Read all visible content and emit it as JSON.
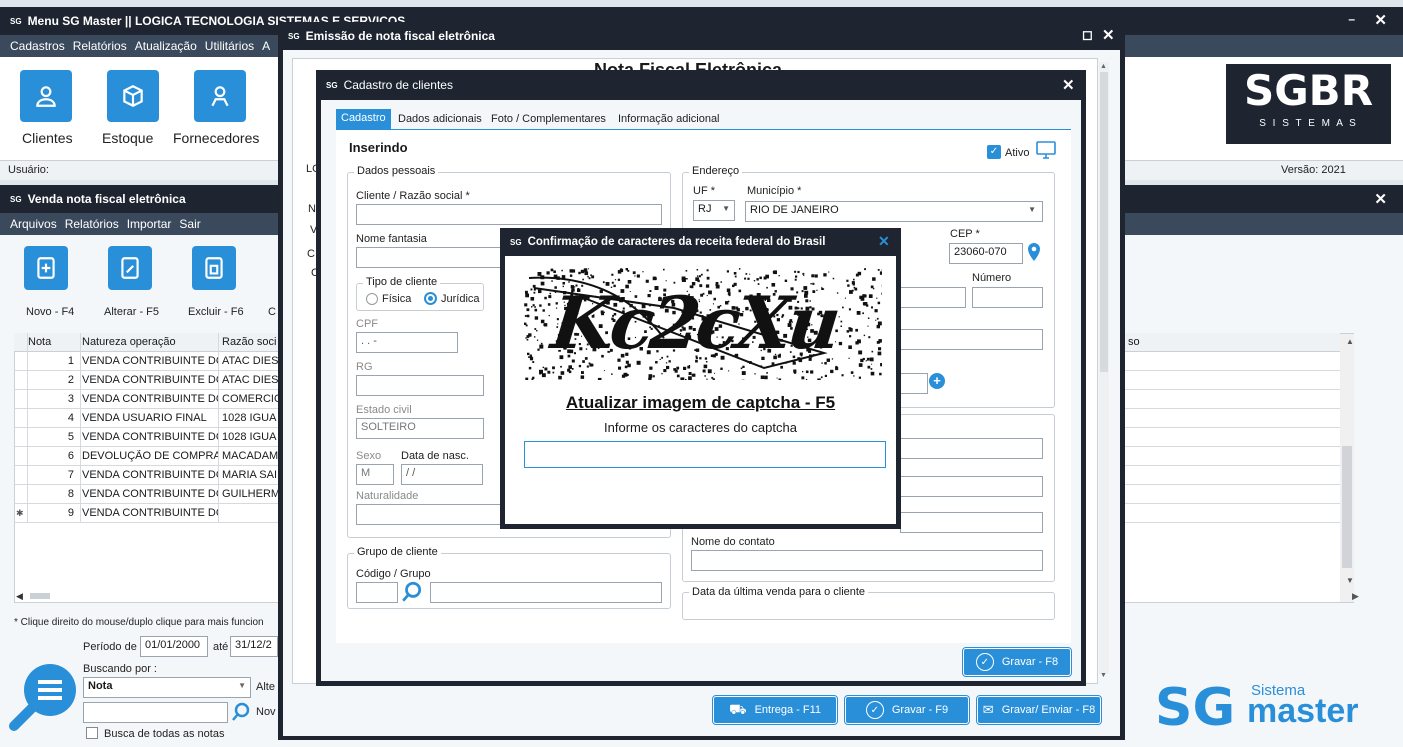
{
  "main_window": {
    "title": "Menu SG Master || LOGICA TECNOLOGIA SISTEMAS E SERVIÇOS",
    "controls": {
      "minimize": "–",
      "close": "✕"
    },
    "menu": [
      "Cadastros",
      "Relatórios",
      "Atualização",
      "Utilitários",
      "A"
    ],
    "tiles": [
      {
        "label": "Clientes",
        "icon": "user-icon"
      },
      {
        "label": "Estoque",
        "icon": "box-icon"
      },
      {
        "label": "Fornecedores",
        "icon": "users-icon"
      }
    ],
    "usuario_label": "Usuário:",
    "versao": "Versão: 2021",
    "logo_text": "SGBR",
    "logo_sub": "S I S T E M A S"
  },
  "venda_window": {
    "title": "Venda nota fiscal eletrônica",
    "menu": [
      "Arquivos",
      "Relatórios",
      "Importar",
      "Sair"
    ],
    "tools": [
      {
        "label": "Novo - F4",
        "icon": "new-document-icon"
      },
      {
        "label": "Alterar - F5",
        "icon": "edit-document-icon"
      },
      {
        "label": "Excluir - F6",
        "icon": "delete-document-icon"
      },
      {
        "label": "C",
        "icon": ""
      }
    ],
    "grid": {
      "columns": [
        "Nota",
        "Natureza operação",
        "Razão soci",
        "so"
      ],
      "rows": [
        {
          "nota": "1",
          "natureza": "VENDA CONTRIBUINTE DO",
          "razao": "ATAC DIES"
        },
        {
          "nota": "2",
          "natureza": "VENDA CONTRIBUINTE DO",
          "razao": "ATAC DIES"
        },
        {
          "nota": "3",
          "natureza": "VENDA CONTRIBUINTE DO",
          "razao": "COMERCIO"
        },
        {
          "nota": "4",
          "natureza": "VENDA USUARIO FINAL",
          "razao": "1028 IGUA"
        },
        {
          "nota": "5",
          "natureza": "VENDA CONTRIBUINTE DO",
          "razao": "1028 IGUA"
        },
        {
          "nota": "6",
          "natureza": "DEVOLUÇÃO DE COMPRA",
          "razao": "MACADAM"
        },
        {
          "nota": "7",
          "natureza": "VENDA CONTRIBUINTE DO",
          "razao": "MARIA SAI"
        },
        {
          "nota": "8",
          "natureza": "VENDA CONTRIBUINTE DO",
          "razao": "GUILHERM"
        },
        {
          "nota": "9",
          "natureza": "VENDA CONTRIBUINTE DO",
          "razao": ""
        }
      ],
      "new_row_marker": "✱"
    },
    "hint": "* Clique direito do mouse/duplo clique para mais funcion",
    "periodo_label": "Período de",
    "periodo_de": "01/01/2000",
    "ate_label": "até",
    "periodo_ate": "31/12/2",
    "buscando_label": "Buscando por :",
    "buscando_value": "Nota",
    "alte_label": "Alte",
    "nov_label": "Nov",
    "busca_todas": "Busca de todas as notas"
  },
  "nfe_window": {
    "title": "Emissão de nota fiscal eletrônica",
    "controls": {
      "maximize": "◻",
      "close": "✕"
    },
    "heading": "Nota Fiscal Eletrônica",
    "side_labels": [
      "LO",
      "N",
      "V",
      "C",
      "C"
    ],
    "buttons": [
      {
        "label": "Entrega - F11",
        "icon": "truck-icon"
      },
      {
        "label": "Gravar - F9",
        "icon": "check-icon"
      },
      {
        "label": "Gravar/ Enviar - F8",
        "icon": "send-icon"
      }
    ]
  },
  "cliente_dialog": {
    "title": "Cadastro de clientes",
    "tabs": [
      "Cadastro",
      "Dados adicionais",
      "Foto / Complementares",
      "Informação adicional"
    ],
    "mode": "Inserindo",
    "ativo_label": "Ativo",
    "dados_pessoais": "Dados pessoais",
    "cliente_label": "Cliente / Razão social *",
    "nome_fantasia_label": "Nome fantasia",
    "tipo_cliente_label": "Tipo de cliente",
    "fisica_label": "Física",
    "juridica_label": "Jurídica",
    "cpf_label": "CPF",
    "cpf_value": "  .  .  -",
    "rg_label": "RG",
    "estado_civil_label": "Estado civil",
    "estado_civil_value": "SOLTEIRO",
    "sexo_label": "Sexo",
    "sexo_value": "M",
    "nasc_label": "Data de nasc.",
    "nasc_value": " / /",
    "naturalidade_label": "Naturalidade",
    "grupo_title": "Grupo de cliente",
    "codigo_grupo_label": "Código / Grupo",
    "endereco_title": "Endereço",
    "uf_label": "UF *",
    "uf_value": "RJ",
    "municipio_label": "Município *",
    "municipio_value": "RIO DE JANEIRO",
    "cep_label": "CEP *",
    "cep_value": "23060-070",
    "numero_label": "Número",
    "contato_label": "Nome do contato",
    "ultima_venda_label": "Data da última venda para o cliente",
    "gravar_button": "Gravar - F8"
  },
  "captcha_dialog": {
    "title": "Confirmação de caracteres da receita federal do Brasil",
    "captcha_text": "Kc2cXu",
    "refresh_link": "Atualizar imagem de captcha - F5",
    "instruction": "Informe os caracteres do captcha",
    "input_value": ""
  },
  "brand": {
    "sistema": "Sistema",
    "master": "master",
    "sg": "SG"
  },
  "colors": {
    "accent": "#2a8fd9",
    "titlebar": "#1e2530",
    "menubar": "#3a4a5c"
  }
}
